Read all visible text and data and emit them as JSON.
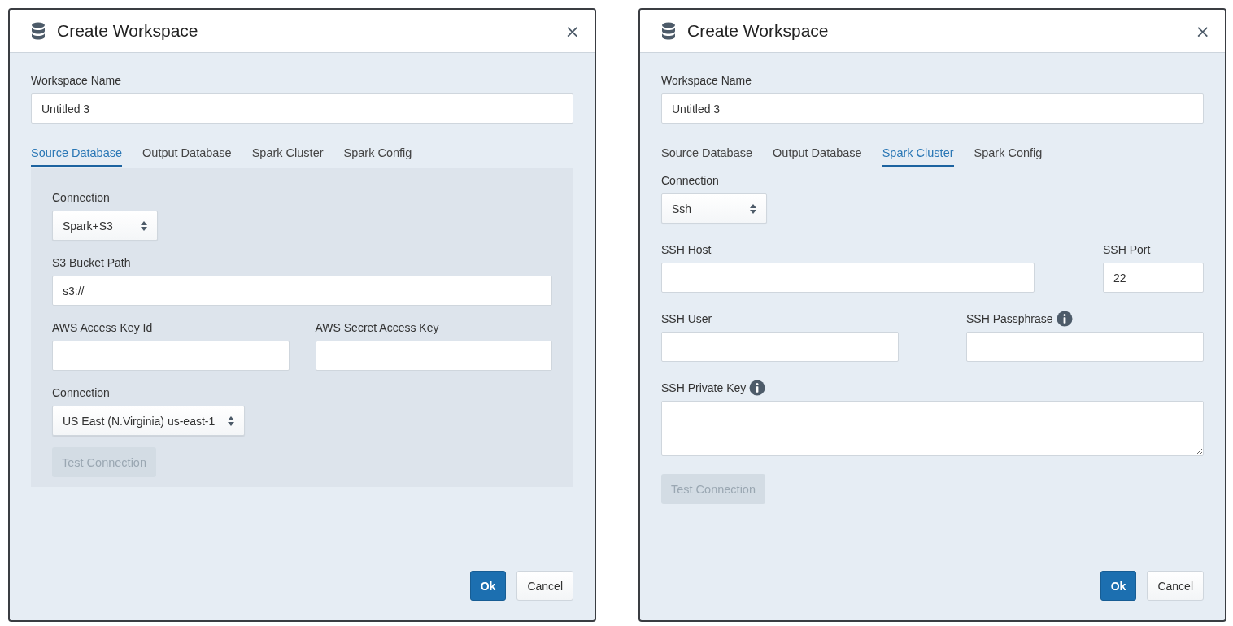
{
  "dialogs": [
    {
      "title": "Create Workspace",
      "close": "×",
      "name_field": {
        "label": "Workspace Name",
        "value": "Untitled 3"
      },
      "tabs": [
        {
          "label": "Source Database",
          "selected": true
        },
        {
          "label": "Output Database",
          "selected": false
        },
        {
          "label": "Spark Cluster",
          "selected": false
        },
        {
          "label": "Spark Config",
          "selected": false
        }
      ],
      "panel": {
        "kind": "well",
        "rows": [
          {
            "kind": "single",
            "fields": [
              {
                "kind": "select",
                "label": "Connection",
                "value": "Spark+S3",
                "info": false
              }
            ]
          },
          {
            "kind": "single",
            "fields": [
              {
                "kind": "input",
                "label": "S3 Bucket Path",
                "value": "s3://",
                "info": false
              }
            ]
          },
          {
            "kind": "pair",
            "fields": [
              {
                "kind": "input",
                "label": "AWS Access Key Id",
                "info": false
              },
              {
                "kind": "input",
                "label": "AWS Secret Access Key",
                "info": false
              }
            ]
          },
          {
            "kind": "single",
            "fields": [
              {
                "kind": "select",
                "label": "Connection",
                "value": "US East (N.Virginia) us-east-1",
                "info": false
              }
            ]
          }
        ],
        "test_button": {
          "label": "Test Connection",
          "disabled": true
        }
      },
      "buttons": [
        {
          "label": "Ok",
          "kind": "primary"
        },
        {
          "label": "Cancel",
          "kind": "default"
        }
      ]
    },
    {
      "title": "Create Workspace",
      "close": "×",
      "name_field": {
        "label": "Workspace Name",
        "value": "Untitled 3"
      },
      "tabs": [
        {
          "label": "Source Database",
          "selected": false
        },
        {
          "label": "Output Database",
          "selected": false
        },
        {
          "label": "Spark Cluster",
          "selected": true
        },
        {
          "label": "Spark Config",
          "selected": false
        }
      ],
      "panel": {
        "kind": "plain",
        "rows": [
          {
            "kind": "single",
            "fields": [
              {
                "kind": "select",
                "label": "Connection",
                "value": "Ssh",
                "info": false
              }
            ]
          },
          {
            "kind": "wide-narrow",
            "fields": [
              {
                "kind": "input",
                "label": "SSH Host",
                "info": false
              },
              {
                "kind": "input",
                "label": "SSH Port",
                "value": "22",
                "info": false
              }
            ]
          },
          {
            "kind": "pair",
            "fields": [
              {
                "kind": "input",
                "label": "SSH User",
                "info": false
              },
              {
                "kind": "input",
                "label": "SSH Passphrase",
                "info": true
              }
            ]
          },
          {
            "kind": "single",
            "fields": [
              {
                "kind": "textarea",
                "label": "SSH Private Key",
                "info": true
              }
            ]
          }
        ],
        "test_button": {
          "label": "Test Connection",
          "disabled": true
        }
      },
      "buttons": [
        {
          "label": "Ok",
          "kind": "primary"
        },
        {
          "label": "Cancel",
          "kind": "default"
        }
      ]
    }
  ]
}
